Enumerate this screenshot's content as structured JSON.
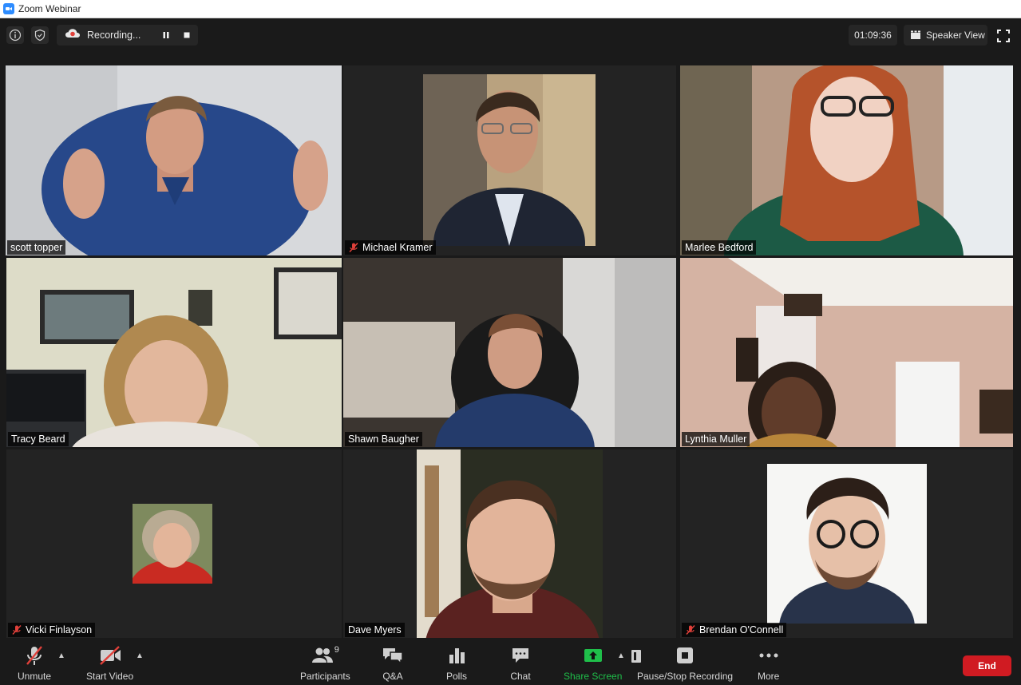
{
  "window": {
    "title": "Zoom Webinar"
  },
  "topbar": {
    "recording_label": "Recording...",
    "timer": "01:09:36",
    "view_label": "Speaker View"
  },
  "participants": [
    {
      "name": "scott topper",
      "muted": false,
      "active_speaker": true
    },
    {
      "name": "Michael Kramer",
      "muted": true
    },
    {
      "name": "Marlee Bedford",
      "muted": false
    },
    {
      "name": "Tracy Beard",
      "muted": false
    },
    {
      "name": "Shawn Baugher",
      "muted": false
    },
    {
      "name": "Lynthia Muller",
      "muted": false
    },
    {
      "name": "Vicki Finlayson",
      "muted": true
    },
    {
      "name": "Dave Myers",
      "muted": false
    },
    {
      "name": "Brendan O'Connell",
      "muted": true
    }
  ],
  "toolbar": {
    "unmute_label": "Unmute",
    "start_video_label": "Start Video",
    "participants_label": "Participants",
    "participants_count": "9",
    "qa_label": "Q&A",
    "polls_label": "Polls",
    "chat_label": "Chat",
    "share_screen_label": "Share Screen",
    "recording_label": "Pause/Stop Recording",
    "more_label": "More",
    "end_label": "End"
  },
  "colors": {
    "active_speaker_border": "#cde56b",
    "share_green": "#1fbf4a",
    "end_red": "#d01b22",
    "mute_red": "#e0403a"
  }
}
